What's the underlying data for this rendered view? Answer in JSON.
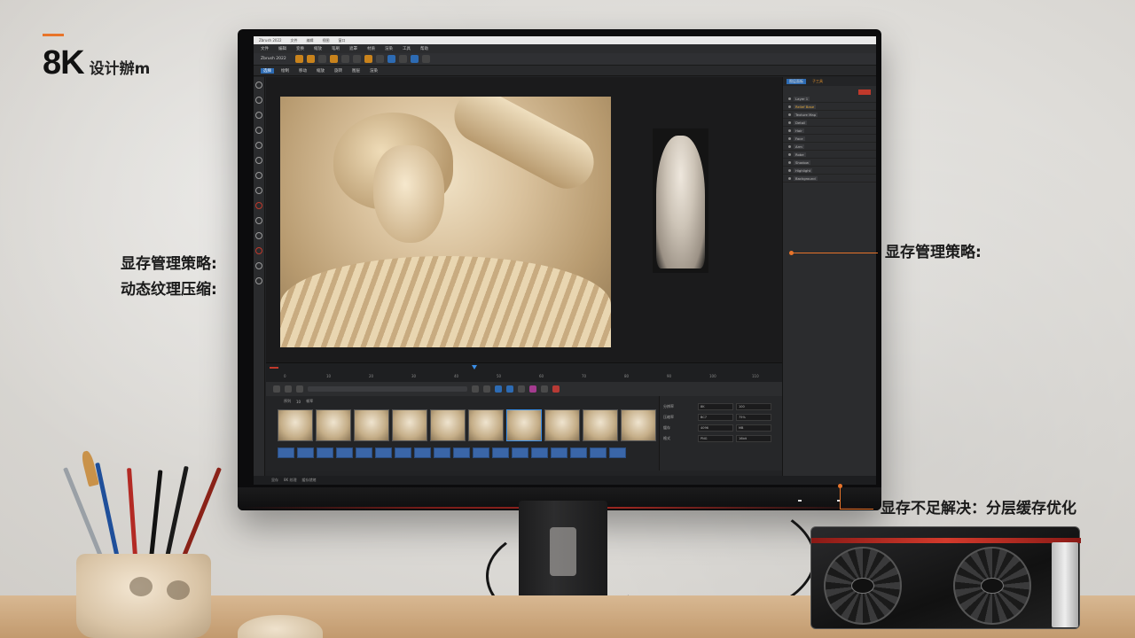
{
  "brand": {
    "big": "8K",
    "small": "设计辦m"
  },
  "annotations": {
    "left_line1": "显存管理策略:",
    "left_line2": "动态纹理压缩:",
    "right_mid": "显存管理策略:",
    "right_bottom": "显存不足解决：分层缓存优化"
  },
  "colors": {
    "accent": "#e8742a",
    "ui_blue": "#2d6bb3",
    "ui_bg": "#222325"
  },
  "screen": {
    "titlebar": [
      "Zbrush 2022",
      "文件",
      "编辑",
      "视图",
      "窗口"
    ],
    "menubar": [
      "文件",
      "编辑",
      "变换",
      "缩放",
      "笔刷",
      "遮罩",
      "材质",
      "渲染",
      "工具",
      "帮助"
    ],
    "toolbar_label": "Zbrush 2022",
    "optbar": [
      "选择",
      "绘制",
      "移动",
      "缩放",
      "旋转",
      "图层",
      "渲染"
    ],
    "right_panel": {
      "tabs": [
        "图层面板",
        "子工具"
      ],
      "layers": [
        "Layer 1",
        "Relief Base",
        "Texture Map",
        "Detail",
        "Hair",
        "Face",
        "Arm",
        "Robe",
        "Shadow",
        "Highlight",
        "Background"
      ]
    },
    "timeline_ticks": [
      "0",
      "10",
      "20",
      "30",
      "40",
      "50",
      "60",
      "70",
      "80",
      "90",
      "100",
      "110"
    ],
    "frames_head": [
      "序列",
      "10",
      "帧率"
    ],
    "props": [
      {
        "label": "分辨率",
        "a": "8K",
        "b": "100"
      },
      {
        "label": "压缩率",
        "a": "BC7",
        "b": "75%"
      },
      {
        "label": "缓存",
        "a": "4096",
        "b": "MB"
      },
      {
        "label": "格式",
        "a": "PNG",
        "b": "16bit"
      }
    ],
    "status": [
      "显存",
      "8K 纹理",
      "缓存就绪"
    ]
  },
  "icons": [
    "brush-icon",
    "move-icon",
    "scale-icon",
    "rotate-icon",
    "mask-icon",
    "eraser-icon",
    "smooth-icon",
    "clay-icon"
  ]
}
